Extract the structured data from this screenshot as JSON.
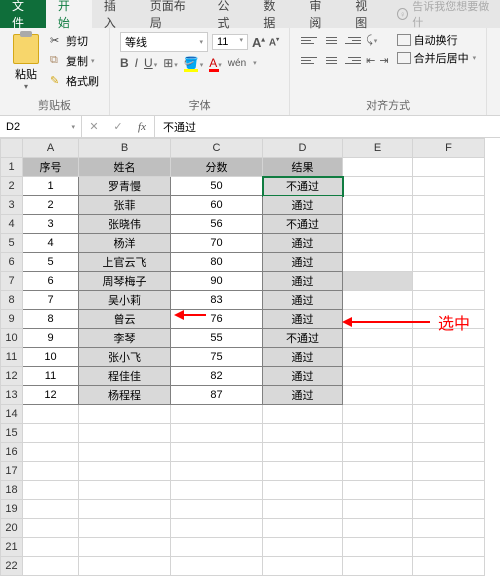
{
  "tabs": {
    "file": "文件",
    "home": "开始",
    "insert": "插入",
    "layout": "页面布局",
    "formula": "公式",
    "data": "数据",
    "review": "审阅",
    "view": "视图",
    "tell": "告诉我您想要做什"
  },
  "ribbon": {
    "clipboard": {
      "label": "剪贴板",
      "paste": "粘贴",
      "cut": "剪切",
      "copy": "复制",
      "fmt": "格式刷"
    },
    "font": {
      "label": "字体",
      "name": "等线",
      "size": "11",
      "bold": "B",
      "italic": "I",
      "underline": "U",
      "wen": "wén"
    },
    "align": {
      "label": "对齐方式",
      "wrap": "自动换行",
      "merge": "合并后居中"
    }
  },
  "namebox": "D2",
  "formula_value": "不通过",
  "columns": [
    "A",
    "B",
    "C",
    "D",
    "E",
    "F"
  ],
  "headers": {
    "A": "序号",
    "B": "姓名",
    "C": "分数",
    "D": "结果"
  },
  "rows": [
    {
      "n": "1",
      "name": "罗青慢",
      "score": "50",
      "res": "不通过"
    },
    {
      "n": "2",
      "name": "张菲",
      "score": "60",
      "res": "通过"
    },
    {
      "n": "3",
      "name": "张晓伟",
      "score": "56",
      "res": "不通过"
    },
    {
      "n": "4",
      "name": "杨洋",
      "score": "70",
      "res": "通过"
    },
    {
      "n": "5",
      "name": "上官云飞",
      "score": "80",
      "res": "通过"
    },
    {
      "n": "6",
      "name": "周琴梅子",
      "score": "90",
      "res": "通过"
    },
    {
      "n": "7",
      "name": "吴小莉",
      "score": "83",
      "res": "通过"
    },
    {
      "n": "8",
      "name": "曾云",
      "score": "76",
      "res": "通过"
    },
    {
      "n": "9",
      "name": "李琴",
      "score": "55",
      "res": "不通过"
    },
    {
      "n": "10",
      "name": "张小飞",
      "score": "75",
      "res": "通过"
    },
    {
      "n": "11",
      "name": "程佳佳",
      "score": "82",
      "res": "通过"
    },
    {
      "n": "12",
      "name": "杨程程",
      "score": "87",
      "res": "通过"
    }
  ],
  "annotation": "选中"
}
